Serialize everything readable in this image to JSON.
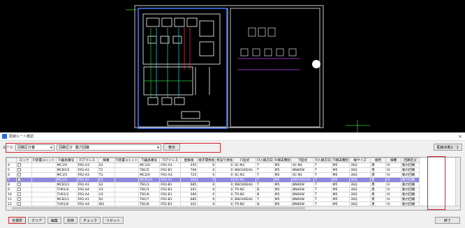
{
  "dialog": {
    "title": "配線ルート確認",
    "close_glyph": "×",
    "route_label": "ルート",
    "route_value": "回路区分番",
    "circuit_value": "回路区分",
    "circuit_code": "動力回路",
    "show_button": "表示",
    "count_button": "配線本数2／2",
    "columns": [
      "ロック",
      "FI装置ユニット",
      "FI器具番号",
      "FIアドレス",
      "線番",
      "TI装置ユニット",
      "TI器具番号",
      "TIアドレス",
      "配線長",
      "端子間余長",
      "折返り余長",
      "FI型式",
      "FI入線方向",
      "FI端末種別",
      "TI型式",
      "TI入線方向",
      "TI端末種別",
      "線サイズ",
      "線色",
      "線種",
      "回路区分"
    ],
    "rows": [
      {
        "no": "4",
        "c": [
          "",
          "",
          "MC1/0",
          "FR2-A3",
          "S3",
          "",
          "MC1/0",
          "FR2-A3",
          "355",
          "0",
          "0",
          "SC-N1",
          "T",
          "M5",
          "SC-N1",
          "T",
          "M5",
          "3SQ",
          "黒",
          "IV",
          "動力回路"
        ]
      },
      {
        "no": "5",
        "c": [
          "",
          "",
          "MCB1/5",
          "FR2-A1",
          "T2",
          "",
          "TB1/5",
          "FR2-B1",
          "706",
          "0",
          "0",
          "BW100EAG",
          "T",
          "M5",
          "BN60W",
          "T",
          "M5",
          "3SQ",
          "黒",
          "IV",
          "動力回路"
        ]
      },
      {
        "no": "6",
        "c": [
          "",
          "",
          "MC1/5",
          "FR2-A3",
          "T3",
          "",
          "MC2/0",
          "FR2-A3",
          "725",
          "0",
          "0",
          "SC-N1",
          "T",
          "M5",
          "SC-N1",
          "T",
          "M5",
          "3SQ",
          "黒",
          "IV",
          "動力回路"
        ]
      },
      {
        "no": "7",
        "c": [
          "",
          "",
          "MC2/5",
          "FR2-A2",
          "U1",
          "",
          "MCB1/0",
          "FR2-A1",
          "382",
          "0",
          "0",
          "SC-N1",
          "T",
          "M5",
          "BW100EAG",
          "T",
          "M5",
          "3SQ",
          "黒",
          "IV",
          "動力回路"
        ]
      },
      {
        "no": "8",
        "c": [
          "",
          "",
          "MCB1/3",
          "FR2-A1",
          "S2",
          "",
          "TB1/3",
          "FR2-B1",
          "685",
          "0",
          "0",
          "BW100EAG",
          "T",
          "M5",
          "BN60W",
          "T",
          "M5",
          "3SQ",
          "黒",
          "IV",
          "動力回路"
        ]
      },
      {
        "no": "9",
        "c": [
          "",
          "",
          "THR1/4",
          "FR2-A4",
          "V3",
          "",
          "TB1/5",
          "FR2-B1",
          "301",
          "0",
          "0",
          "TR-N2",
          "B",
          "M5",
          "BN60W",
          "T",
          "M5",
          "3SQ",
          "黒",
          "IV",
          "動力回路"
        ]
      },
      {
        "no": "10",
        "c": [
          "",
          "",
          "THR1/2",
          "FR2-A4",
          "U3",
          "",
          "TB1/6",
          "FR2-B1",
          "366",
          "0",
          "0",
          "TR-N2",
          "B",
          "M5",
          "BN60W",
          "T",
          "M5",
          "3SQ",
          "黒",
          "IV",
          "動力回路"
        ]
      },
      {
        "no": "11",
        "c": [
          "",
          "",
          "MCB1/1",
          "FR2-A1",
          "R2",
          "",
          "TB1/7",
          "FR2-B1",
          "685",
          "0",
          "0",
          "BW100EAG",
          "T",
          "M5",
          "BN60W",
          "T",
          "M5",
          "3SQ",
          "黒",
          "IV",
          "動力回路"
        ]
      },
      {
        "no": "12",
        "c": [
          "",
          "",
          "THR1/6",
          "FR2-A4",
          "W3",
          "",
          "TB1/8",
          "FR2-B1",
          "301",
          "0",
          "0",
          "TR-N2",
          "B",
          "M5",
          "BN60W",
          "T",
          "M5",
          "3SQ",
          "黒",
          "IV",
          "動力回路"
        ]
      }
    ],
    "selected_row": 3,
    "bottom_buttons": [
      "全選択",
      "クリア",
      "編集",
      "反映",
      "チェック",
      "リセット"
    ],
    "end_button": "終了"
  },
  "colors": {
    "highlight": "#d9232a",
    "selected_row": "#8e87de",
    "accent": "#2b6cd4"
  }
}
